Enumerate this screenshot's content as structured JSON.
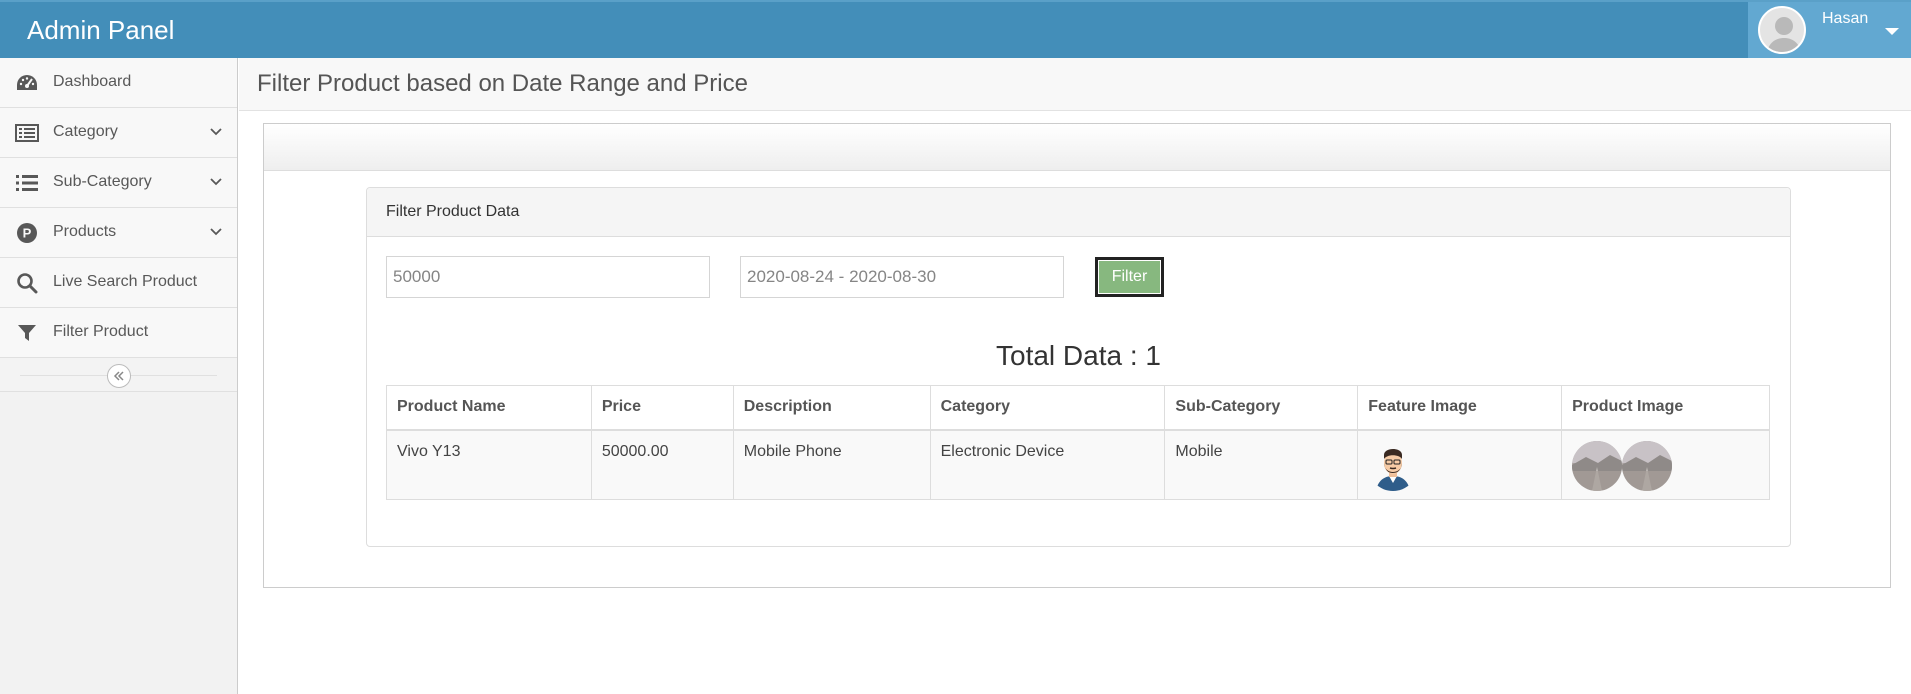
{
  "navbar": {
    "brand": "Admin Panel",
    "user_name": "Hasan"
  },
  "sidebar": {
    "items": [
      {
        "label": "Dashboard",
        "icon": "dashboard-icon",
        "has_submenu": false
      },
      {
        "label": "Category",
        "icon": "list-alt-icon",
        "has_submenu": true
      },
      {
        "label": "Sub-Category",
        "icon": "list-icon",
        "has_submenu": true
      },
      {
        "label": "Products",
        "icon": "product-p-icon",
        "has_submenu": true
      },
      {
        "label": "Live Search Product",
        "icon": "search-icon",
        "has_submenu": false
      },
      {
        "label": "Filter Product",
        "icon": "filter-icon",
        "has_submenu": false
      }
    ]
  },
  "page": {
    "title": "Filter Product based on Date Range and Price"
  },
  "panel": {
    "title": "Filter Product Data"
  },
  "filters": {
    "price_value": "50000",
    "date_range_value": "2020-08-24 - 2020-08-30",
    "filter_button": "Filter"
  },
  "total": {
    "label": "Total Data : 1"
  },
  "table": {
    "headers": [
      "Product Name",
      "Price",
      "Description",
      "Category",
      "Sub-Category",
      "Feature Image",
      "Product Image"
    ],
    "rows": [
      {
        "name": "Vivo Y13",
        "price": "50000.00",
        "description": "Mobile Phone",
        "category": "Electronic Device",
        "sub_category": "Mobile"
      }
    ]
  },
  "colors": {
    "navbar": "#438eb9",
    "user_box": "#62a8d1",
    "filter_button": "#87b87f",
    "sidebar": "#f2f2f2"
  }
}
